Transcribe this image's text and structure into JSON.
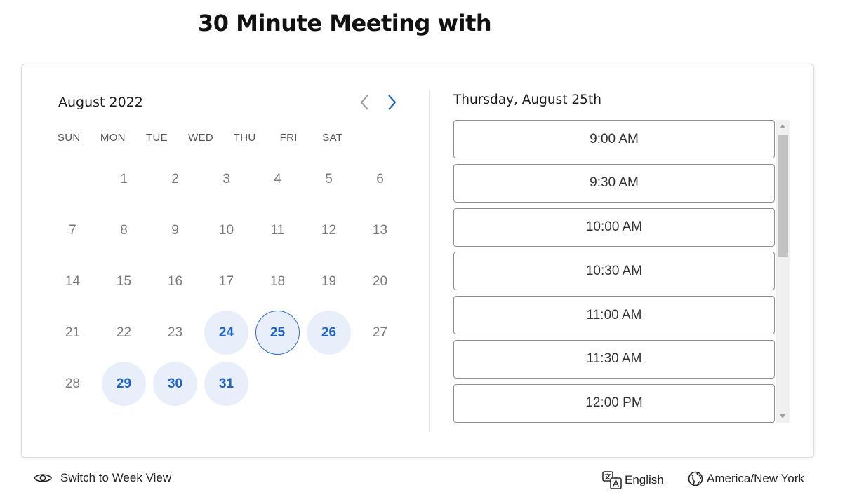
{
  "title": "30 Minute Meeting with",
  "calendar": {
    "month_label": "August 2022",
    "weekdays": [
      "SUN",
      "MON",
      "TUE",
      "WED",
      "THU",
      "FRI",
      "SAT"
    ],
    "leading_blanks": 1,
    "days": [
      {
        "label": "1",
        "state": "unavailable"
      },
      {
        "label": "2",
        "state": "unavailable"
      },
      {
        "label": "3",
        "state": "unavailable"
      },
      {
        "label": "4",
        "state": "unavailable"
      },
      {
        "label": "5",
        "state": "unavailable"
      },
      {
        "label": "6",
        "state": "unavailable"
      },
      {
        "label": "7",
        "state": "unavailable"
      },
      {
        "label": "8",
        "state": "unavailable"
      },
      {
        "label": "9",
        "state": "unavailable"
      },
      {
        "label": "10",
        "state": "unavailable"
      },
      {
        "label": "11",
        "state": "unavailable"
      },
      {
        "label": "12",
        "state": "unavailable"
      },
      {
        "label": "13",
        "state": "unavailable"
      },
      {
        "label": "14",
        "state": "unavailable"
      },
      {
        "label": "15",
        "state": "unavailable"
      },
      {
        "label": "16",
        "state": "unavailable"
      },
      {
        "label": "17",
        "state": "unavailable"
      },
      {
        "label": "18",
        "state": "unavailable"
      },
      {
        "label": "19",
        "state": "unavailable"
      },
      {
        "label": "20",
        "state": "unavailable"
      },
      {
        "label": "21",
        "state": "unavailable"
      },
      {
        "label": "22",
        "state": "unavailable"
      },
      {
        "label": "23",
        "state": "unavailable"
      },
      {
        "label": "24",
        "state": "available"
      },
      {
        "label": "25",
        "state": "selected"
      },
      {
        "label": "26",
        "state": "available"
      },
      {
        "label": "27",
        "state": "unavailable"
      },
      {
        "label": "28",
        "state": "unavailable"
      },
      {
        "label": "29",
        "state": "available"
      },
      {
        "label": "30",
        "state": "available"
      },
      {
        "label": "31",
        "state": "available"
      }
    ],
    "prev_icon": "chevron-left-icon",
    "next_icon": "chevron-right-icon"
  },
  "slots": {
    "date_heading": "Thursday, August 25th",
    "times": [
      "9:00 AM",
      "9:30 AM",
      "10:00 AM",
      "10:30 AM",
      "11:00 AM",
      "11:30 AM",
      "12:00 PM"
    ]
  },
  "footer": {
    "week_view_label": "Switch to Week View",
    "week_view_icon": "eye-icon",
    "language_label": "English",
    "language_icon": "translate-icon",
    "timezone_label": "America/New York",
    "timezone_icon": "globe-icon"
  },
  "colors": {
    "accent": "#1d63c9",
    "available_bg": "#e8effb",
    "unavailable_text": "#7a7a7a",
    "slot_border": "#8f8f8f"
  }
}
